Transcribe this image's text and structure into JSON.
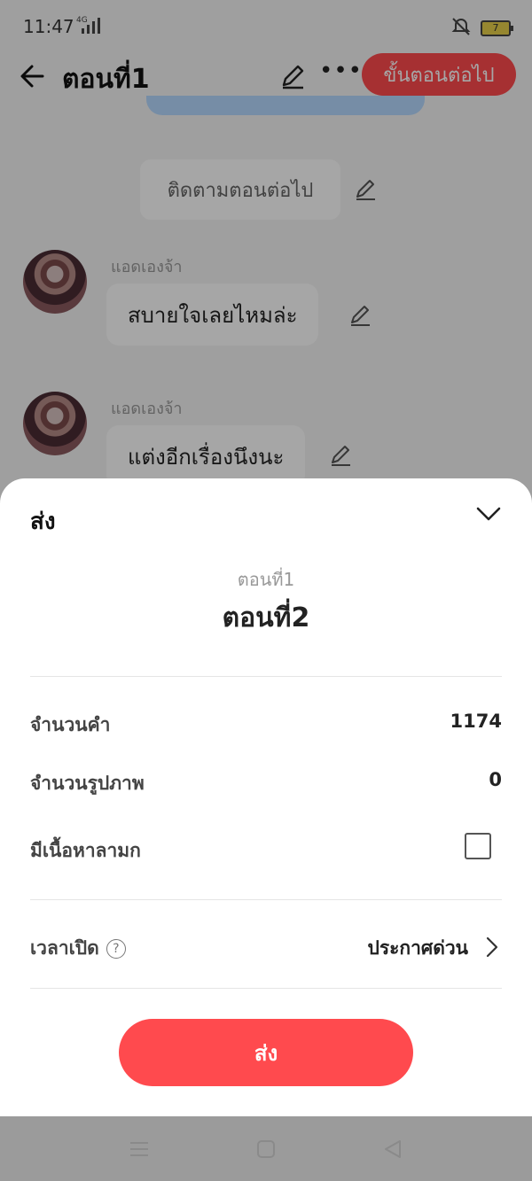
{
  "status": {
    "time": "11:47",
    "network": "4G",
    "battery": "7"
  },
  "topbar": {
    "title": "ตอนที่1",
    "next_label": "ขั้นตอนต่อไป"
  },
  "chat": {
    "follow_text": "ติดตามตอนต่อไป",
    "messages": [
      {
        "name": "แอดเองจ้า",
        "text": "สบายใจเลยไหมล่ะ"
      },
      {
        "name": "แอดเองจ้า",
        "text": "แต่งอีกเรื่องนึงนะ"
      }
    ]
  },
  "sheet": {
    "title": "ส่ง",
    "from_episode": "ตอนที่1",
    "to_episode": "ตอนที่2",
    "rows": [
      {
        "label": "จำนวนคำ",
        "value": "1174"
      },
      {
        "label": "จำนวนรูปภาพ",
        "value": "0"
      },
      {
        "label": "มีเนื้อหาลามก",
        "checked": false
      }
    ],
    "open_time_label": "เวลาเปิด",
    "open_time_help": "?",
    "open_time_value": "ประกาศด่วน",
    "send_label": "ส่ง"
  },
  "colors": {
    "accent": "#ff4a4e",
    "bubble_blue": "#b6d9ff"
  }
}
